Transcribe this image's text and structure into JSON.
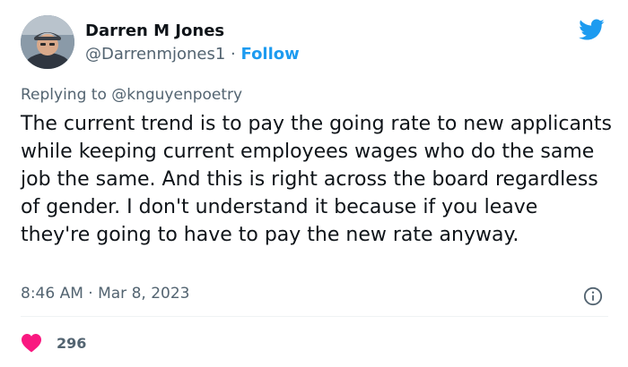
{
  "author": {
    "name": "Darren M Jones",
    "handle": "@Darrenmjones1",
    "separator": " · ",
    "follow_label": "Follow"
  },
  "reply": {
    "prefix": "Replying to ",
    "mention": "@knguyenpoetry"
  },
  "tweet": {
    "text": "The current trend is to pay the going rate to new applicants while keeping current employees wages who do the same job the same. And this is right across the board regardless of gender. I don't understand it because if you leave they're going to have to pay the new rate anyway.",
    "timestamp": "8:46 AM · Mar 8, 2023",
    "like_count": "296"
  },
  "colors": {
    "accent": "#1d9bf0",
    "like": "#f91880",
    "muted": "#536471",
    "text": "#0f1419"
  },
  "icons": {
    "brand": "twitter-bird-icon",
    "info": "info-icon",
    "like": "heart-icon"
  }
}
